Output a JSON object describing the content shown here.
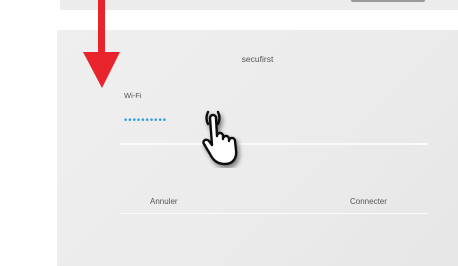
{
  "dialog": {
    "title": "secufirst",
    "field_label": "Wi-Fi",
    "field_value": "••••••••••",
    "cancel_label": "Annuler",
    "connect_label": "Connecter"
  },
  "icons": {
    "annotation_arrow": "down-arrow-icon",
    "pointer": "tap-hand-icon"
  },
  "colors": {
    "arrow": "#e8232b",
    "password_dots": "#2f9de0",
    "dialog_bg": "#ededed"
  }
}
